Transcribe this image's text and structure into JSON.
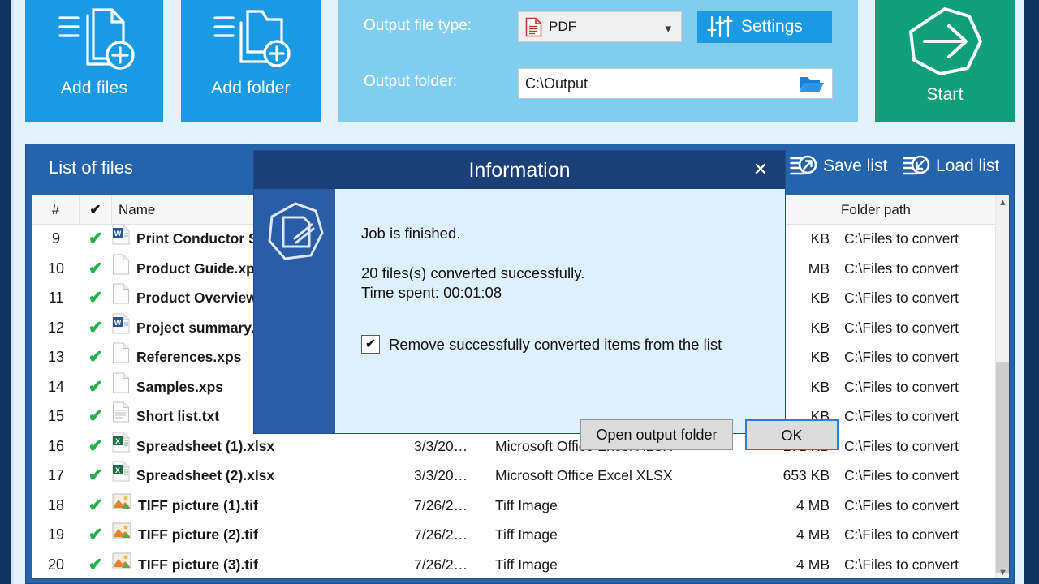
{
  "toolbar": {
    "add_files_label": "Add files",
    "add_folder_label": "Add folder",
    "output_file_type_label": "Output file type:",
    "output_file_type_value": "PDF",
    "settings_label": "Settings",
    "output_folder_label": "Output folder:",
    "output_folder_value": "C:\\Output",
    "start_label": "Start"
  },
  "list_panel": {
    "title": "List of files",
    "save_list_label": "Save list",
    "load_list_label": "Load list",
    "columns": [
      "#",
      "✔",
      "Name",
      "",
      "",
      "",
      "Folder path"
    ],
    "column_num": "#",
    "column_check": "✔",
    "column_name": "Name",
    "column_folder_path": "Folder path",
    "rows": [
      {
        "num": "9",
        "checked": "✔",
        "name": "Print Conductor S…",
        "icon": "word-file-icon",
        "date": "",
        "type": "",
        "size": "KB",
        "path": "C:\\Files to convert"
      },
      {
        "num": "10",
        "checked": "✔",
        "name": "Product Guide.xps",
        "icon": "xps-file-icon",
        "date": "",
        "type": "",
        "size": "MB",
        "path": "C:\\Files to convert"
      },
      {
        "num": "11",
        "checked": "✔",
        "name": "Product Overview.",
        "icon": "xps-file-icon",
        "date": "",
        "type": "",
        "size": "KB",
        "path": "C:\\Files to convert"
      },
      {
        "num": "12",
        "checked": "✔",
        "name": "Project summary.d",
        "icon": "word-file-icon",
        "date": "",
        "type": "",
        "size": "KB",
        "path": "C:\\Files to convert"
      },
      {
        "num": "13",
        "checked": "✔",
        "name": "References.xps",
        "icon": "xps-file-icon",
        "date": "",
        "type": "",
        "size": "KB",
        "path": "C:\\Files to convert"
      },
      {
        "num": "14",
        "checked": "✔",
        "name": "Samples.xps",
        "icon": "xps-file-icon",
        "date": "",
        "type": "",
        "size": "KB",
        "path": "C:\\Files to convert"
      },
      {
        "num": "15",
        "checked": "✔",
        "name": "Short list.txt",
        "icon": "text-file-icon",
        "date": "",
        "type": "",
        "size": "KB",
        "path": "C:\\Files to convert"
      },
      {
        "num": "16",
        "checked": "✔",
        "name": "Spreadsheet (1).xlsx",
        "icon": "excel-file-icon",
        "date": "3/3/20…",
        "type": "Microsoft Office Excel XLSX",
        "size": "172 KB",
        "path": "C:\\Files to convert"
      },
      {
        "num": "17",
        "checked": "✔",
        "name": "Spreadsheet (2).xlsx",
        "icon": "excel-file-icon",
        "date": "3/3/20…",
        "type": "Microsoft Office Excel XLSX",
        "size": "653 KB",
        "path": "C:\\Files to convert"
      },
      {
        "num": "18",
        "checked": "✔",
        "name": "TIFF picture (1).tif",
        "icon": "tiff-image-icon",
        "date": "7/26/2…",
        "type": "Tiff Image",
        "size": "4 MB",
        "path": "C:\\Files to convert"
      },
      {
        "num": "19",
        "checked": "✔",
        "name": "TIFF picture (2).tif",
        "icon": "tiff-image-icon",
        "date": "7/26/2…",
        "type": "Tiff Image",
        "size": "4 MB",
        "path": "C:\\Files to convert"
      },
      {
        "num": "20",
        "checked": "✔",
        "name": "TIFF picture (3).tif",
        "icon": "tiff-image-icon",
        "date": "7/26/2…",
        "type": "Tiff Image",
        "size": "4 MB",
        "path": "C:\\Files to convert"
      }
    ]
  },
  "dialog": {
    "title": "Information",
    "close_label": "✕",
    "line1": "Job is finished.",
    "line2": "20 files(s) converted successfully.",
    "line3": "Time spent: 00:01:08",
    "checkbox_checked": "✔",
    "checkbox_label": "Remove successfully converted items from the list",
    "open_folder_label": "Open output folder",
    "ok_label": "OK"
  },
  "colors": {
    "accent_blue": "#1b9ae4",
    "panel_blue": "#81cdf0",
    "start_green": "#0fa07a",
    "list_header_blue": "#2464ad",
    "dialog_title_navy": "#1b3f76",
    "dialog_side_blue": "#2a5ca8",
    "dialog_body": "#ddf0fb",
    "check_green": "#22b14c",
    "focus_border": "#2a7fd4"
  }
}
